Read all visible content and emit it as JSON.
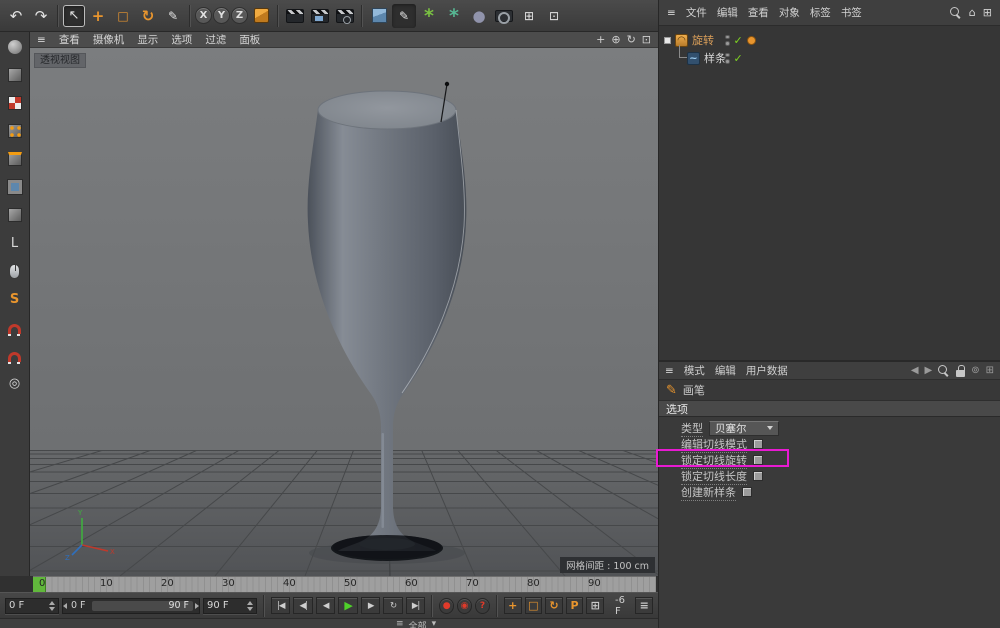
{
  "top_toolbar": {
    "icons": [
      {
        "name": "undo-icon",
        "glyph": "↶"
      },
      {
        "name": "redo-icon",
        "glyph": "↷"
      },
      {
        "name": "live-selection-tool",
        "glyph": "↖"
      },
      {
        "name": "move-tool",
        "glyph": "+"
      },
      {
        "name": "scale-tool",
        "glyph": "□"
      },
      {
        "name": "rotate-tool",
        "glyph": "↻"
      },
      {
        "name": "last-used-tool",
        "glyph": "✎"
      },
      {
        "name": "lock-x-axis",
        "glyph": "X"
      },
      {
        "name": "lock-y-axis",
        "glyph": "Y"
      },
      {
        "name": "lock-z-axis",
        "glyph": "Z"
      },
      {
        "name": "coordinate-system",
        "glyph": ""
      },
      {
        "name": "render-view",
        "glyph": ""
      },
      {
        "name": "render-picture-viewer",
        "glyph": ""
      },
      {
        "name": "render-settings",
        "glyph": ""
      },
      {
        "name": "add-primitive",
        "glyph": ""
      },
      {
        "name": "spline-pen-tool",
        "glyph": "✎"
      },
      {
        "name": "mograph-menu",
        "glyph": "*"
      },
      {
        "name": "simulate-menu",
        "glyph": "*"
      },
      {
        "name": "deformer-menu",
        "glyph": "●"
      },
      {
        "name": "camera-menu",
        "glyph": ""
      },
      {
        "name": "display-menu",
        "glyph": "⊞"
      },
      {
        "name": "content-menu",
        "glyph": "⊡"
      }
    ]
  },
  "right_menubar": {
    "menu_icon": "≡",
    "items": [
      "文件",
      "编辑",
      "查看",
      "对象",
      "标签",
      "书签"
    ],
    "right_icons": [
      {
        "name": "find-icon",
        "glyph": ""
      },
      {
        "name": "home-icon",
        "glyph": "⌂"
      },
      {
        "name": "panel-menu-icon",
        "glyph": "⊞"
      }
    ]
  },
  "viewport": {
    "menu_icon": "≡",
    "menu": [
      "查看",
      "摄像机",
      "显示",
      "选项",
      "过滤",
      "面板"
    ],
    "nav_icons": [
      {
        "name": "pan-view-icon",
        "glyph": "+"
      },
      {
        "name": "zoom-view-icon",
        "glyph": "⊕"
      },
      {
        "name": "rotate-view-icon",
        "glyph": "↻"
      },
      {
        "name": "toggle-view-icon",
        "glyph": "⊡"
      }
    ],
    "view_label": "透视视图",
    "grid_label": "网格间距 : 100 cm"
  },
  "object_manager": {
    "objects": [
      {
        "name": "旋转",
        "type": "lathe",
        "icon": "lathe-icon",
        "enabled": true
      },
      {
        "name": "样条",
        "type": "spline",
        "icon": "spline-icon",
        "enabled": true
      }
    ]
  },
  "attributes": {
    "menu_icon": "≡",
    "tabs": [
      "模式",
      "编辑",
      "用户数据"
    ],
    "right_icons": [
      {
        "name": "history-back-icon",
        "glyph": "◀"
      },
      {
        "name": "history-forward-icon",
        "glyph": "▶"
      },
      {
        "name": "find-icon",
        "glyph": ""
      },
      {
        "name": "lock-icon",
        "glyph": ""
      },
      {
        "name": "follow-icon",
        "glyph": "⊚"
      },
      {
        "name": "panel-menu-icon",
        "glyph": "⊞"
      }
    ],
    "tool_icon": "✎",
    "tool_name": "画笔",
    "section_label": "选项",
    "type_label": "类型",
    "type_value": "贝塞尔",
    "params": [
      {
        "label": "编辑切线模式",
        "checked": false
      },
      {
        "label": "锁定切线旋转",
        "checked": false,
        "highlighted": true
      },
      {
        "label": "锁定切线长度",
        "checked": false
      },
      {
        "label": "创建新样条",
        "checked": false
      }
    ],
    "highlight_color": "#e81ad2"
  },
  "timeline": {
    "ticks": [
      "0",
      "10",
      "20",
      "30",
      "40",
      "50",
      "60",
      "70",
      "80",
      "90"
    ],
    "current_frame_index": 0
  },
  "transport": {
    "current_frame": "0 F",
    "range_start": "0 F",
    "range_end": "90 F",
    "end_frame": "90 F",
    "frame_offset": "-6 F",
    "buttons": [
      {
        "name": "goto-start-button",
        "glyph": "|◀"
      },
      {
        "name": "prev-key-button",
        "glyph": "◀|"
      },
      {
        "name": "prev-frame-button",
        "glyph": "◀"
      },
      {
        "name": "play-button",
        "glyph": "▶"
      },
      {
        "name": "next-frame-button",
        "glyph": "▶"
      },
      {
        "name": "loop-button",
        "glyph": "↻"
      },
      {
        "name": "goto-end-button",
        "glyph": "▶|"
      }
    ],
    "record_buttons": [
      {
        "name": "record-keyframe-button",
        "glyph": "●"
      },
      {
        "name": "autokey-button",
        "glyph": "◉"
      },
      {
        "name": "help-button",
        "glyph": "?"
      }
    ],
    "key_buttons": [
      {
        "name": "key-position-button",
        "glyph": "+"
      },
      {
        "name": "key-scale-button",
        "glyph": "□"
      },
      {
        "name": "key-rotation-button",
        "glyph": "↻"
      },
      {
        "name": "key-parameter-button",
        "glyph": "P"
      },
      {
        "name": "key-pla-button",
        "glyph": "⊞"
      },
      {
        "name": "timeline-menu-button",
        "glyph": "≡"
      }
    ]
  },
  "bottom_strip": {
    "menu_icon": "≡",
    "label": "全部",
    "arrow": "▾"
  },
  "left_toolbar": {
    "icons": [
      "make-editable",
      "model-mode",
      "texture-mode",
      "points-mode",
      "edges-mode",
      "polygons-mode",
      "object-mode",
      "axis-mode",
      "viewport-select",
      "solo-mode",
      "snap-toggle",
      "snap-settings",
      "quantize-toggle"
    ]
  },
  "colors": {
    "accent_orange": "#e8952e",
    "play_green": "#4fd02a",
    "highlight_magenta": "#e81ad2",
    "enabled_green": "#7ed321",
    "viewport_gray": "#6e7071"
  }
}
